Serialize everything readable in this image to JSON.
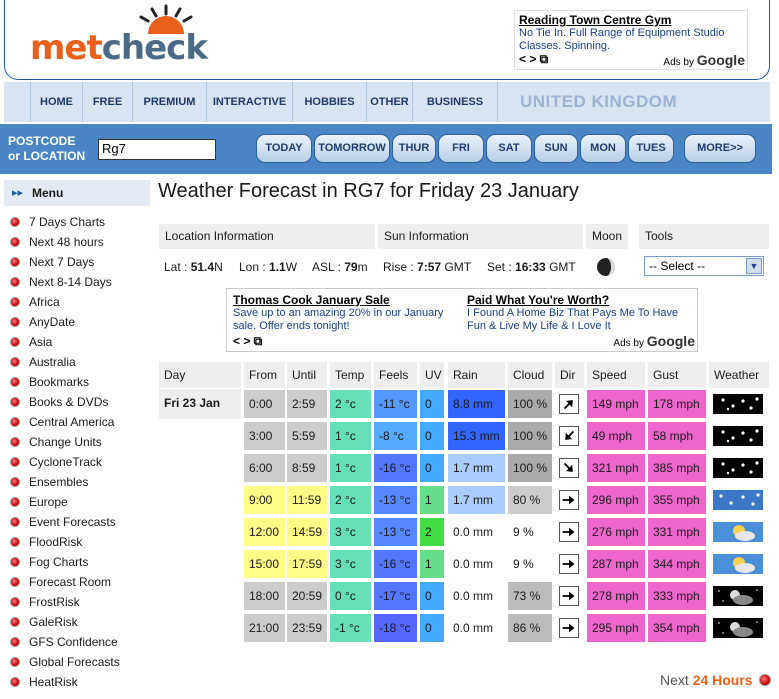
{
  "logo": {
    "part1": "met",
    "part2": "check"
  },
  "ad_top": {
    "title": "Reading Town Centre Gym",
    "text": "No Tie In. Full Range of Equipment Studio Classes. Spinning.",
    "nav": "< > ⧉",
    "adsby_prefix": "Ads by",
    "adsby_brand": "Google"
  },
  "nav": {
    "items": [
      "HOME",
      "FREE",
      "PREMIUM",
      "INTERACTIVE",
      "HOBBIES",
      "OTHER",
      "BUSINESS"
    ],
    "region": "UNITED KINGDOM"
  },
  "postcode": {
    "label_line1": "POSTCODE",
    "label_line2": "or LOCATION",
    "value": "Rg7"
  },
  "days": [
    "TODAY",
    "TOMORROW",
    "THUR",
    "FRI",
    "SAT",
    "SUN",
    "MON",
    "TUES",
    "MORE>>"
  ],
  "sidebar": {
    "menu_label": "Menu",
    "items": [
      "7 Days Charts",
      "Next 48 hours",
      "Next 7 Days",
      "Next 8-14 Days",
      "Africa",
      "AnyDate",
      "Asia",
      "Australia",
      "Bookmarks",
      "Books & DVDs",
      "Central America",
      "Change Units",
      "CycloneTrack",
      "Ensembles",
      "Europe",
      "Event Forecasts",
      "FloodRisk",
      "Fog Charts",
      "Forecast Room",
      "FrostRisk",
      "GaleRisk",
      "GFS Confidence",
      "Global Forecasts",
      "HeatRisk"
    ]
  },
  "title": "Weather Forecast in RG7 for Friday 23 January",
  "info": {
    "location_header": "Location Information",
    "sun_header": "Sun Information",
    "moon_header": "Moon",
    "tools_header": "Tools",
    "lat_label": "Lat :",
    "lat_value": "51.4",
    "lat_dir": "N",
    "lon_label": "Lon :",
    "lon_value": "1.1",
    "lon_dir": "W",
    "asl_label": "ASL :",
    "asl_value": "79",
    "asl_unit": "m",
    "rise_label": "Rise :",
    "rise_value": "7:57",
    "rise_tz": "GMT",
    "set_label": "Set :",
    "set_value": "16:33",
    "set_tz": "GMT",
    "tools_select": "-- Select --"
  },
  "ad_mid": {
    "left_title": "Thomas Cook January Sale",
    "left_text": "Save up to an amazing 20% in our January sale. Offer ends tonight!",
    "right_title": "Paid What You're Worth?",
    "right_text": "I Found A Home Biz That Pays Me To Have Fun & Live My Life & I Love It",
    "nav": "< > ⧉",
    "adsby_prefix": "Ads by",
    "adsby_brand": "Google"
  },
  "forecast": {
    "headers": [
      "Day",
      "From",
      "Until",
      "Temp",
      "Feels",
      "UV",
      "Rain",
      "Cloud",
      "Dir",
      "Speed",
      "Gust",
      "Weather"
    ],
    "day_label": "Fri 23 Jan",
    "rows": [
      {
        "from": "0:00",
        "until": "2:59",
        "temp": "2 °c",
        "feels": "-11 °c",
        "uv": "0",
        "rain": "8.8 mm",
        "cloud": "100 %",
        "dir": "NE",
        "speed": "149 mph",
        "gust": "178 mph",
        "weather": "snow-night",
        "from_bg": "#cccccc",
        "temp_bg": "#66e0b8",
        "feels_bg": "#5599ff",
        "rain_bg": "#3366ff",
        "cloud_bg": "#aaaaaa"
      },
      {
        "from": "3:00",
        "until": "5:59",
        "temp": "1 °c",
        "feels": "-8 °c",
        "uv": "0",
        "rain": "15.3 mm",
        "cloud": "100 %",
        "dir": "SW",
        "speed": "49 mph",
        "gust": "58 mph",
        "weather": "snow-night",
        "from_bg": "#cccccc",
        "temp_bg": "#66e0b8",
        "feels_bg": "#55aaff",
        "rain_bg": "#3366ff",
        "cloud_bg": "#aaaaaa"
      },
      {
        "from": "6:00",
        "until": "8:59",
        "temp": "1 °c",
        "feels": "-16 °c",
        "uv": "0",
        "rain": "1.7 mm",
        "cloud": "100 %",
        "dir": "SE",
        "speed": "321 mph",
        "gust": "385 mph",
        "weather": "snow-night",
        "from_bg": "#cccccc",
        "temp_bg": "#66e0b8",
        "feels_bg": "#5577ff",
        "rain_bg": "#aaccff",
        "cloud_bg": "#aaaaaa"
      },
      {
        "from": "9:00",
        "until": "11:59",
        "temp": "2 °c",
        "feels": "-13 °c",
        "uv": "1",
        "rain": "1.7 mm",
        "cloud": "80 %",
        "dir": "E",
        "speed": "296 mph",
        "gust": "355 mph",
        "weather": "snow-day",
        "from_bg": "#ffff88",
        "temp_bg": "#66e0b8",
        "feels_bg": "#5588ff",
        "rain_bg": "#aaccff",
        "cloud_bg": "#cccccc"
      },
      {
        "from": "12:00",
        "until": "14:59",
        "temp": "3 °c",
        "feels": "-13 °c",
        "uv": "2",
        "rain": "0.0 mm",
        "cloud": "9 %",
        "dir": "E",
        "speed": "276 mph",
        "gust": "331 mph",
        "weather": "sun-cloud",
        "from_bg": "#ffff88",
        "temp_bg": "#66e0b8",
        "feels_bg": "#5588ff",
        "rain_bg": "#ffffff",
        "cloud_bg": "#ffffff"
      },
      {
        "from": "15:00",
        "until": "17:59",
        "temp": "3 °c",
        "feels": "-16 °c",
        "uv": "1",
        "rain": "0.0 mm",
        "cloud": "9 %",
        "dir": "E",
        "speed": "287 mph",
        "gust": "344 mph",
        "weather": "sun-cloud",
        "from_bg": "#ffff88",
        "temp_bg": "#66e0b8",
        "feels_bg": "#5577ff",
        "rain_bg": "#ffffff",
        "cloud_bg": "#ffffff"
      },
      {
        "from": "18:00",
        "until": "20:59",
        "temp": "0 °c",
        "feels": "-17 °c",
        "uv": "0",
        "rain": "0.0 mm",
        "cloud": "73 %",
        "dir": "E",
        "speed": "278 mph",
        "gust": "333 mph",
        "weather": "moon-cloud",
        "from_bg": "#cccccc",
        "temp_bg": "#66e0b8",
        "feels_bg": "#5577ff",
        "rain_bg": "#ffffff",
        "cloud_bg": "#bbbbbb"
      },
      {
        "from": "21:00",
        "until": "23:59",
        "temp": "-1 °c",
        "feels": "-18 °c",
        "uv": "0",
        "rain": "0.0 mm",
        "cloud": "86 %",
        "dir": "E",
        "speed": "295 mph",
        "gust": "354 mph",
        "weather": "moon-cloud",
        "from_bg": "#cccccc",
        "temp_bg": "#66e0b8",
        "feels_bg": "#5566ff",
        "rain_bg": "#ffffff",
        "cloud_bg": "#bbbbbb"
      }
    ]
  },
  "next": {
    "prefix": "Next",
    "label": "24 Hours"
  },
  "colors": {
    "uv_0": "#44aaff",
    "uv_1": "#66dd88",
    "uv_2": "#44dd44",
    "speed": "#ee66cc",
    "gust": "#ee66cc",
    "accent": "#e8601a",
    "nav_blue": "#4a86c6"
  }
}
